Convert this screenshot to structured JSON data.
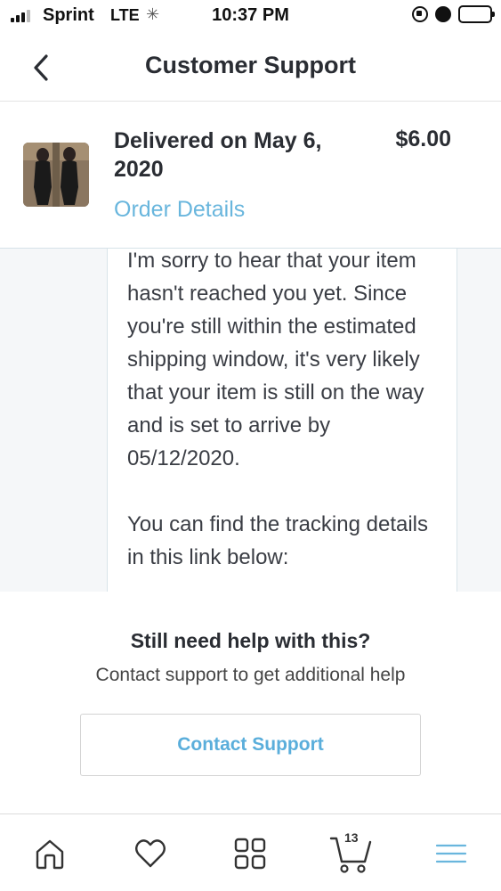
{
  "status_bar": {
    "carrier": "Sprint",
    "network": "LTE",
    "time": "10:37 PM"
  },
  "header": {
    "title": "Customer Support"
  },
  "order": {
    "delivered_text": "Delivered on May 6, 2020",
    "price": "$6.00",
    "details_link": "Order Details"
  },
  "chat": {
    "paragraph_1": "I'm sorry to hear that your item hasn't reached you yet. Since you're still within the estimated shipping window, it's very likely that your item is still on the way and is set to arrive by 05/12/2020.",
    "paragraph_2": "You can find the tracking details in this link below:"
  },
  "help": {
    "title": "Still need help with this?",
    "subtitle": "Contact support to get additional help",
    "button_label": "Contact Support"
  },
  "tabbar": {
    "items": [
      "home-icon",
      "heart-icon",
      "grid-icon",
      "cart-icon",
      "menu-icon"
    ],
    "cart_count": "13",
    "active_color": "#69b6dd"
  },
  "colors": {
    "link": "#69b6dd",
    "title": "#2a2d33",
    "chat_bg": "#f5f7f9"
  }
}
